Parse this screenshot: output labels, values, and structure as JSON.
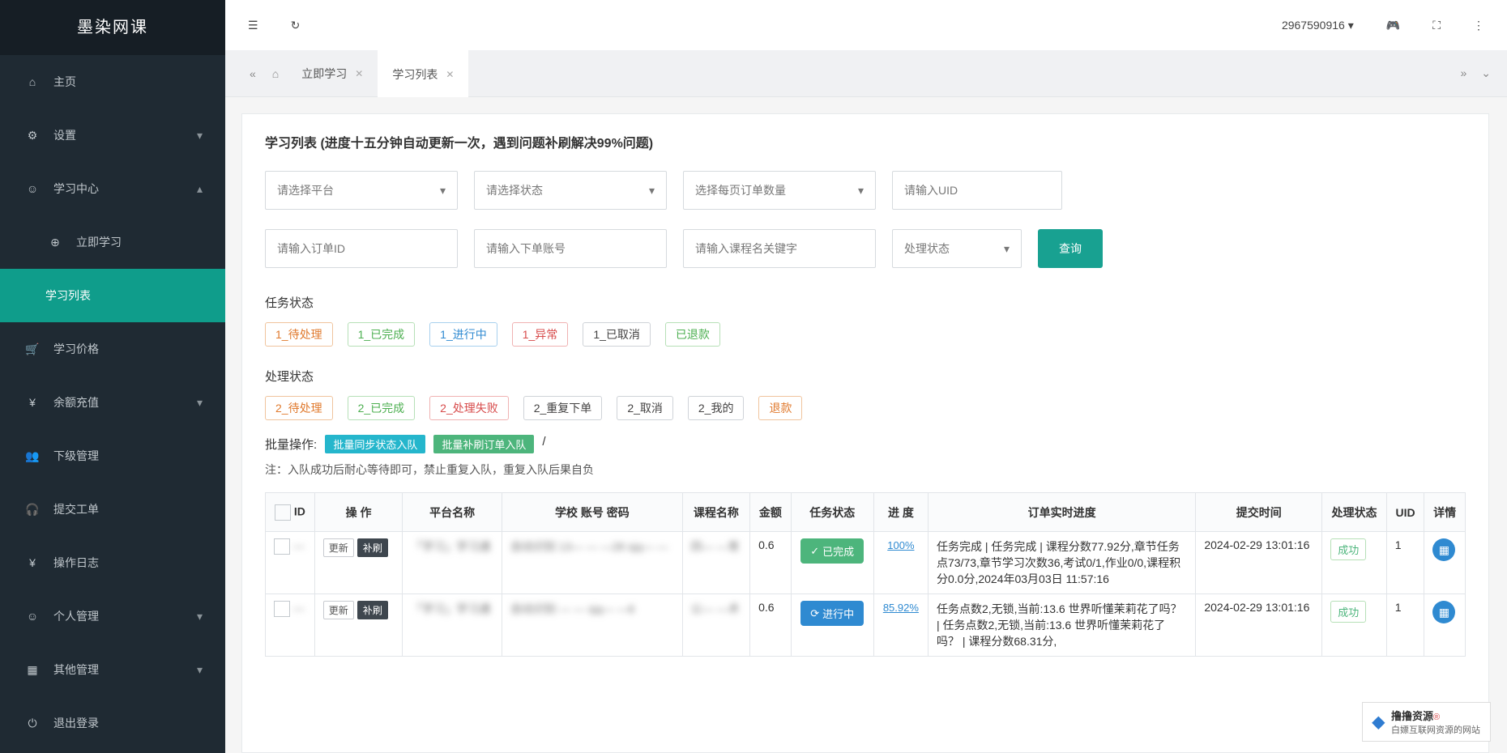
{
  "app": {
    "title": "墨染网课"
  },
  "topbar": {
    "user_id": "2967590916"
  },
  "sidebar": {
    "items": [
      {
        "label": "主页",
        "icon": "home"
      },
      {
        "label": "设置",
        "icon": "gear",
        "chev": "down"
      },
      {
        "label": "学习中心",
        "icon": "user",
        "chev": "up"
      },
      {
        "label": "立即学习",
        "icon": "plus",
        "sub": true
      },
      {
        "label": "学习列表",
        "icon": "",
        "sub": true,
        "active": true
      },
      {
        "label": "学习价格",
        "icon": "cart"
      },
      {
        "label": "余额充值",
        "icon": "yen",
        "chev": "down"
      },
      {
        "label": "下级管理",
        "icon": "users"
      },
      {
        "label": "提交工单",
        "icon": "headset"
      },
      {
        "label": "操作日志",
        "icon": "yen"
      },
      {
        "label": "个人管理",
        "icon": "user",
        "chev": "down"
      },
      {
        "label": "其他管理",
        "icon": "grid",
        "chev": "down"
      },
      {
        "label": "退出登录",
        "icon": "power"
      }
    ]
  },
  "tabs": {
    "t1": "立即学习",
    "t2": "学习列表"
  },
  "page": {
    "title": "学习列表 (进度十五分钟自动更新一次，遇到问题补刷解决99%问题)"
  },
  "filters": {
    "platform": "请选择平台",
    "status": "请选择状态",
    "perpage": "选择每页订单数量",
    "uid": "请输入UID",
    "orderid": "请输入订单ID",
    "account": "请输入下单账号",
    "course": "请输入课程名关键字",
    "proc": "处理状态",
    "query": "查询"
  },
  "taskstatus": {
    "label": "任务状态",
    "tags": [
      "1_待处理",
      "1_已完成",
      "1_进行中",
      "1_异常",
      "1_已取消",
      "已退款"
    ]
  },
  "procstatus": {
    "label": "处理状态",
    "tags": [
      "2_待处理",
      "2_已完成",
      "2_处理失败",
      "2_重复下单",
      "2_取消",
      "2_我的",
      "退款"
    ]
  },
  "batch": {
    "label": "批量操作:",
    "b1": "批量同步状态入队",
    "b2": "批量补刷订单入队",
    "sep": "/",
    "note": "注：入队成功后耐心等待即可，禁止重复入队，重复入队后果自负"
  },
  "table": {
    "headers": [
      "ID",
      "操  作",
      "平台名称",
      "学校 账号 密码",
      "课程名称",
      "金额",
      "任务状态",
      "进  度",
      "订单实时进度",
      "提交时间",
      "处理状态",
      "UID",
      "详情"
    ],
    "rows": [
      {
        "id": "—",
        "update": "更新",
        "refresh": "补刷",
        "platform": "「学习」学习通",
        "school": "自动识别 13— — —28 sjq— —",
        "course": "四— —育",
        "amount": "0.6",
        "task": "已完成",
        "task_icon": "✓",
        "pct": "100%",
        "progress": "任务完成 | 任务完成 | 课程分数77.92分,章节任务点73/73,章节学习次数36,考试0/1,作业0/0,课程积分0.0分,2024年03月03日 11:57:16",
        "time": "2024-02-29 13:01:16",
        "proc": "成功",
        "uid": "1"
      },
      {
        "id": "—",
        "update": "更新",
        "refresh": "补刷",
        "platform": "「学习」学习通",
        "school": "自动识别 — — sjq— —6",
        "course": "公— —术",
        "amount": "0.6",
        "task": "进行中",
        "task_icon": "⟳",
        "pct": "85.92%",
        "progress": "任务点数2,无锁,当前:13.6 世界听懂茉莉花了吗？ | 任务点数2,无锁,当前:13.6 世界听懂茉莉花了吗？ | 课程分数68.31分,",
        "time": "2024-02-29 13:01:16",
        "proc": "成功",
        "uid": "1"
      }
    ]
  },
  "watermark": {
    "brand": "撸撸资源",
    "sub": "白嫖互联网资源的网站",
    "r": "®"
  }
}
